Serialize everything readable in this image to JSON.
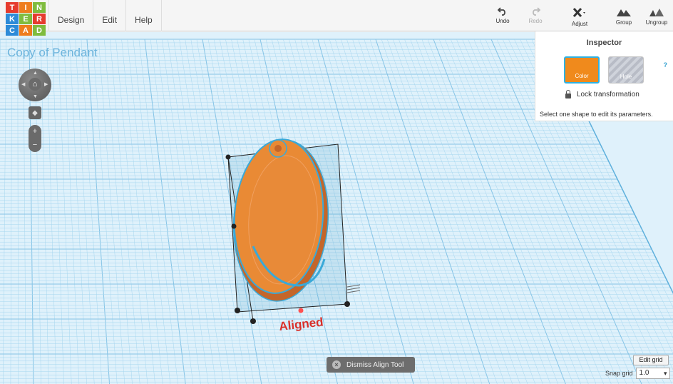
{
  "app": {
    "logo_letters": [
      "T",
      "I",
      "N",
      "K",
      "E",
      "R",
      "C",
      "A",
      "D"
    ],
    "logo_colors": [
      "#e63b2e",
      "#ee7d1e",
      "#7fbc3e",
      "#2e8bd8",
      "#7fbc3e",
      "#e63b2e",
      "#2e8bd8",
      "#ee7d1e",
      "#7fbc3e"
    ]
  },
  "menu": {
    "design": "Design",
    "edit": "Edit",
    "help": "Help"
  },
  "toolbar": {
    "undo": "Undo",
    "redo": "Redo",
    "adjust": "Adjust",
    "group": "Group",
    "ungroup": "Ungroup"
  },
  "design_name": "Copy of Pendant",
  "inspector": {
    "title": "Inspector",
    "help": "?",
    "color_label": "Color",
    "hole_label": "Hole",
    "lock_label": "Lock transformation",
    "hint": "Select one shape to edit its parameters.",
    "selected_color": "#f08a1c"
  },
  "canvas": {
    "aligned_label": "Aligned",
    "dismiss_label": "Dismiss Align Tool",
    "edit_grid": "Edit grid",
    "snap_label": "Snap grid",
    "snap_value": "1.0"
  },
  "colors": {
    "workplane": "#dff1fb",
    "grid_line": "#a6d6ef",
    "shape": "#e98a35",
    "outline": "#3aa9d8",
    "aligned_text": "#d9302a"
  }
}
